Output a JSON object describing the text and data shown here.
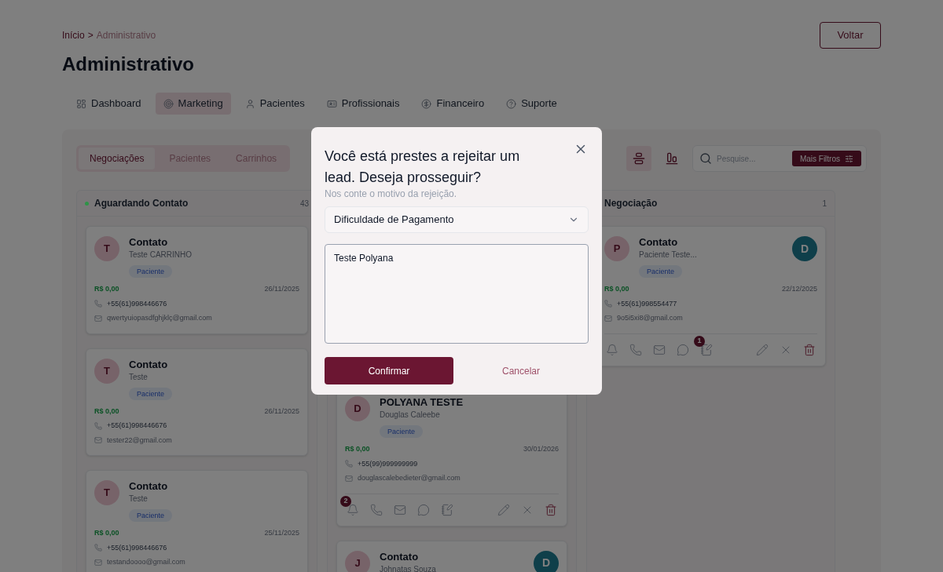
{
  "breadcrumb": {
    "items": [
      "Início",
      "Administrativo"
    ],
    "separator": ">"
  },
  "back_button": "Voltar",
  "title": "Administrativo",
  "nav": [
    {
      "label": "Dashboard",
      "selected": false
    },
    {
      "label": "Marketing",
      "selected": true
    },
    {
      "label": "Pacientes",
      "selected": false
    },
    {
      "label": "Profissionais",
      "selected": false
    },
    {
      "label": "Financeiro",
      "selected": false
    },
    {
      "label": "Suporte",
      "selected": false
    }
  ],
  "segments": [
    {
      "label": "Negociações",
      "selected": true
    },
    {
      "label": "Pacientes",
      "selected": false
    },
    {
      "label": "Carrinhos",
      "selected": false
    }
  ],
  "view_toggles": [
    {
      "kind": "rows",
      "selected": true
    },
    {
      "kind": "columns",
      "selected": false
    }
  ],
  "search": {
    "placeholder": "Pesquise..."
  },
  "filters_button": "Mais Filtros",
  "columns": [
    {
      "title": "Aguardando Contato",
      "count": "43",
      "color": "#2e9447",
      "cards": [
        {
          "avatar": "T",
          "title": "Contato",
          "subtitle": "Teste CARRINHO",
          "tag": "Paciente",
          "value": "R$ 0,00",
          "date": "26/11/2025",
          "phone": "+55(61)998446676",
          "email": "qwertyuiopasdfghjklç@gmail.com"
        },
        {
          "avatar": "T",
          "title": "Contato",
          "subtitle": "Teste",
          "tag": "Paciente",
          "value": "R$ 0,00",
          "date": "26/11/2025",
          "phone": "+55(61)998446676",
          "email": "tester22@gmail.com"
        },
        {
          "avatar": "T",
          "title": "Contato",
          "subtitle": "Teste",
          "tag": "Paciente",
          "value": "R$ 0,00",
          "date": "25/11/2025",
          "phone": "+55(61)998446676",
          "email": "testandoooo@gmail.com"
        }
      ]
    },
    {
      "cards": [
        {
          "avatar": "D",
          "title": "POLYANA TESTE",
          "subtitle": "Douglas Caleebe",
          "tag": "Paciente",
          "value": "R$ 0,00",
          "date": "30/01/2026",
          "phone": "+55(99)999999999",
          "email": "douglascalebedieter@gmail.com",
          "actions": [
            {
              "kind": "bell",
              "badge": "2"
            },
            {
              "kind": "phone"
            },
            {
              "kind": "mail"
            },
            {
              "kind": "chat"
            },
            {
              "kind": "notes"
            },
            {
              "kind": "edit"
            },
            {
              "kind": "reject"
            },
            {
              "kind": "delete"
            }
          ]
        },
        {
          "avatar": "J",
          "title": "Contato",
          "subtitle": "Johnatas Souza",
          "assignee": "D"
        }
      ]
    },
    {
      "title": "Negociação",
      "count": "1",
      "cards": [
        {
          "avatar": "P",
          "title": "Contato",
          "subtitle": "Paciente Teste...",
          "assignee": "D",
          "tag": "Paciente",
          "value": "R$ 0,00",
          "date": "22/12/2025",
          "phone": "+55(61)998554477",
          "email": "9o5i5xi8@gmail.com",
          "actions": [
            {
              "kind": "bell"
            },
            {
              "kind": "phone"
            },
            {
              "kind": "mail"
            },
            {
              "kind": "chat"
            },
            {
              "kind": "notes",
              "badge": "1"
            },
            {
              "kind": "edit"
            },
            {
              "kind": "reject"
            },
            {
              "kind": "delete"
            }
          ]
        }
      ]
    }
  ],
  "modal": {
    "title": "Você está prestes a rejeitar um lead. Deseja prosseguir?",
    "subtitle": "Nos conte o motivo da rejeição.",
    "reason": "Dificuldade de Pagamento",
    "comment": "Teste Polyana",
    "confirm": "Confirmar",
    "cancel": "Cancelar"
  }
}
